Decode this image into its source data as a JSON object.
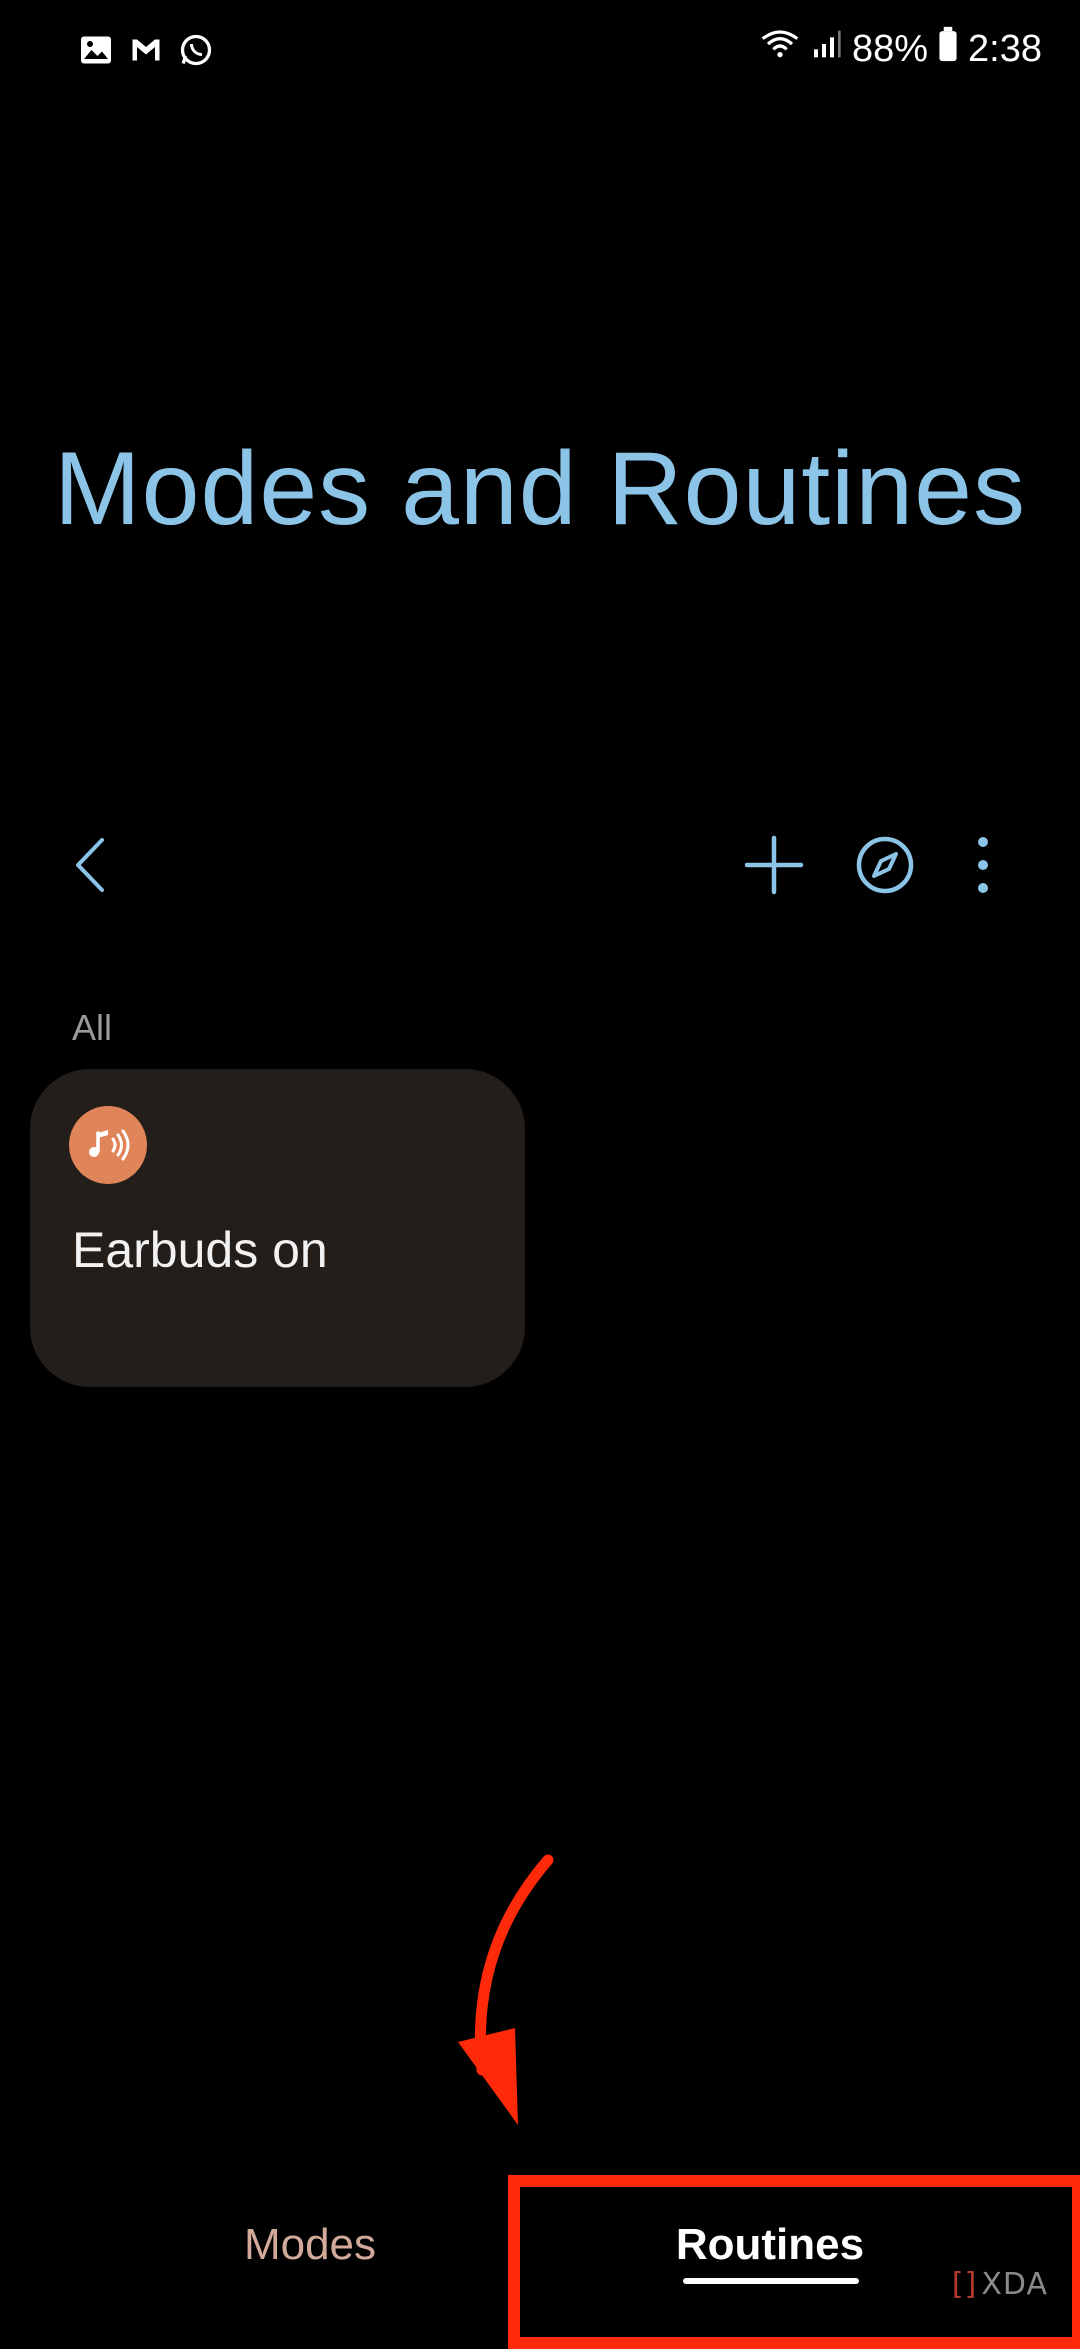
{
  "status_bar": {
    "battery": "88%",
    "time": "2:38",
    "left_icons": [
      "gallery-icon",
      "gmail-icon",
      "whatsapp-icon"
    ],
    "right_icons": [
      "wifi-icon",
      "signal-icon",
      "battery-icon"
    ]
  },
  "title": "Modes and Routines",
  "toolbar": {
    "icons": [
      "back-icon",
      "add-icon",
      "discover-icon",
      "more-icon"
    ]
  },
  "section": {
    "label": "All"
  },
  "routines": [
    {
      "title": "Earbuds on",
      "icon": "earbuds-audio-icon",
      "icon_color": "#e0845a"
    }
  ],
  "bottom_tabs": {
    "modes": "Modes",
    "routines": "Routines",
    "active": "Routines"
  },
  "colors": {
    "accent": "#8cc4e8",
    "highlight": "#ff2a0a",
    "card_bg": "#241e1b"
  },
  "watermark": "XDA"
}
